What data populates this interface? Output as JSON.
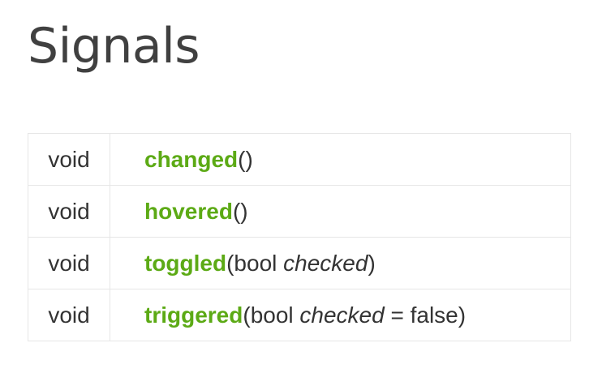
{
  "page": {
    "title": "Signals"
  },
  "signals": [
    {
      "type": "void",
      "name": "changed",
      "open": "(",
      "param_type": "",
      "param_name": "",
      "default": "",
      "close": ")"
    },
    {
      "type": "void",
      "name": "hovered",
      "open": "(",
      "param_type": "",
      "param_name": "",
      "default": "",
      "close": ")"
    },
    {
      "type": "void",
      "name": "toggled",
      "open": "(",
      "param_type": "bool ",
      "param_name": "checked",
      "default": "",
      "close": ")"
    },
    {
      "type": "void",
      "name": "triggered",
      "open": "(",
      "param_type": "bool ",
      "param_name": "checked",
      "default": " = false",
      "close": ")"
    }
  ],
  "colors": {
    "function_name": "#5caa15",
    "text": "#333333",
    "border": "#e6e6e6"
  }
}
